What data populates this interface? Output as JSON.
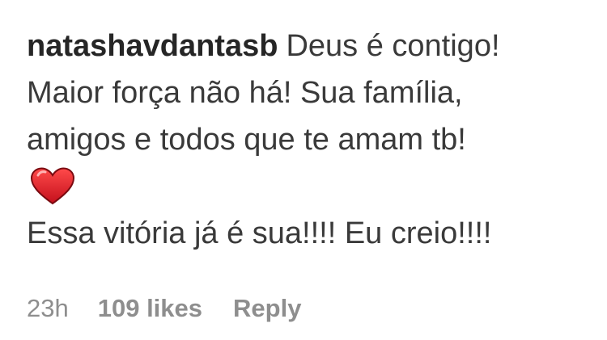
{
  "comment": {
    "username": "natashavdantasb",
    "lines": [
      "Deus é contigo!",
      "Maior força não há! Sua família,",
      "amigos e todos que te amam tb!",
      "Essa vitória já é sua!!!! Eu creio!!!!"
    ],
    "emoji_icon": "red-heart-icon"
  },
  "meta": {
    "time": "23h",
    "likes": "109 likes",
    "reply_label": "Reply"
  },
  "colors": {
    "text": "#262626",
    "muted": "#8e8e8e",
    "heart": "#e0202a"
  }
}
